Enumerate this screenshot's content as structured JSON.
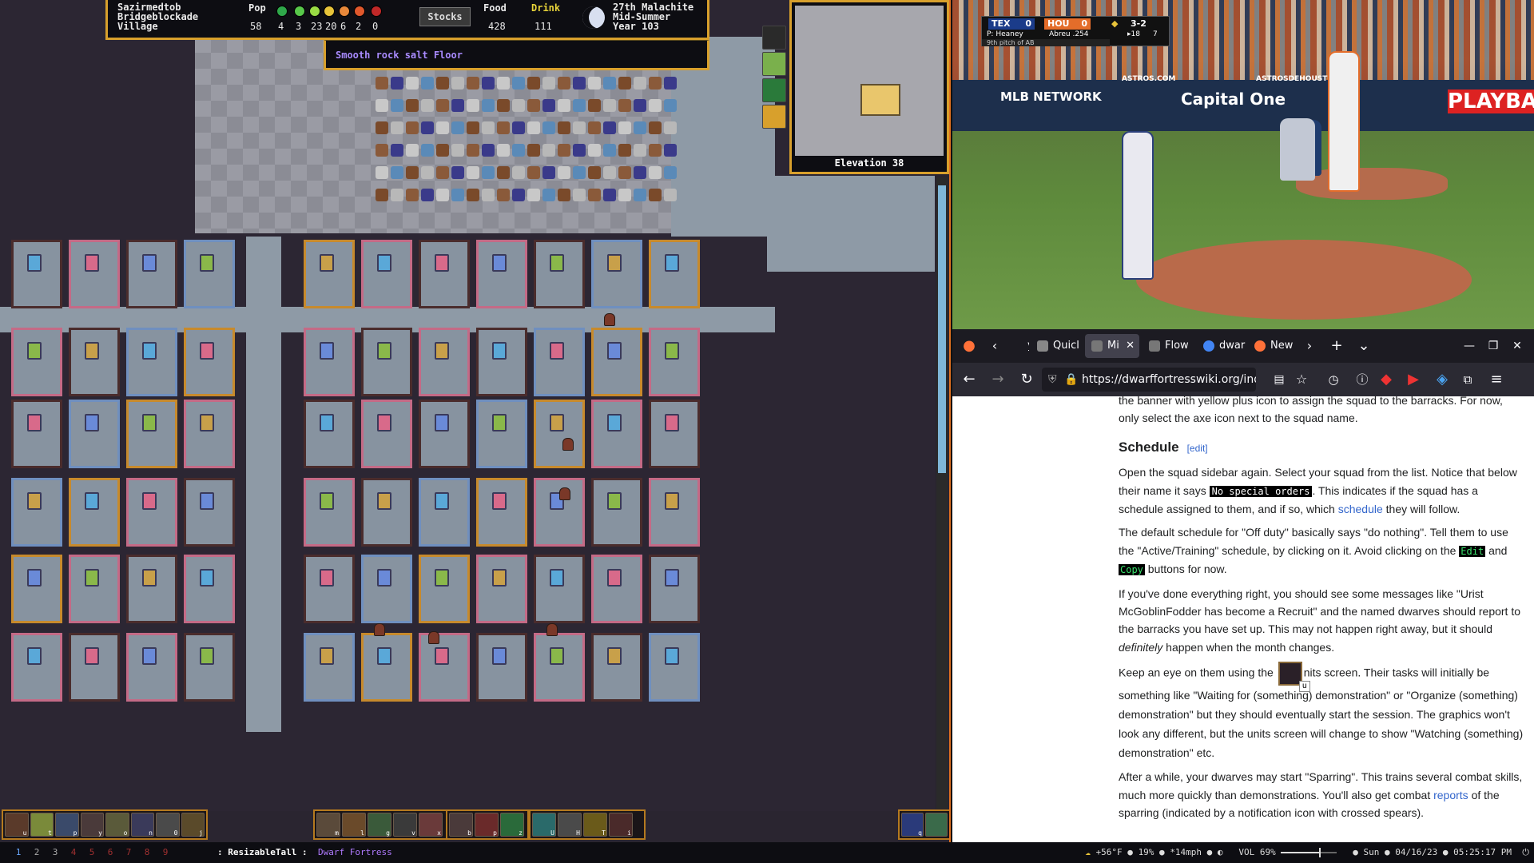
{
  "df": {
    "fort_lines": [
      "Sazirmedtob",
      "Bridgeblockade",
      "Village"
    ],
    "pop_label": "Pop",
    "pop_value": "58",
    "happiness_counts": [
      "4",
      "3",
      "23",
      "20",
      "6",
      "2",
      "0"
    ],
    "happiness_colors": [
      "#2fa84a",
      "#58c84a",
      "#9adc44",
      "#e8c43a",
      "#e8883a",
      "#e0582c",
      "#c02828"
    ],
    "stocks_label": "Stocks",
    "food_label": "Food",
    "food_value": "428",
    "drink_label": "Drink",
    "drink_value": "111",
    "date_lines": [
      "27th Malachite",
      "Mid-Summer",
      "Year 103"
    ],
    "hover_text": "Smooth rock salt Floor",
    "elevation": "Elevation 38",
    "toolbar_left_keys": [
      "u",
      "t",
      "p",
      "y",
      "o",
      "n",
      "0",
      "j"
    ],
    "toolbar_mid1_keys": [
      "m",
      "l",
      "g",
      "v",
      "x"
    ],
    "toolbar_mid2_keys": [
      "b",
      "p",
      "z"
    ],
    "toolbar_mid3_keys": [
      "U",
      "H",
      "T",
      "i"
    ],
    "toolbar_right_keys": [
      "q",
      ""
    ]
  },
  "video": {
    "away_team": "TEX",
    "away_score": "0",
    "home_team": "HOU",
    "home_score": "0",
    "count": "3-2",
    "inning": "▸18",
    "pitches": "7",
    "pitcher_label": "P: Heaney",
    "batter_label": "Abreu .254",
    "pitch_info": "9th pitch of AB",
    "ads": [
      "MLB NETWORK",
      "Capital One",
      "ASTROS.COM",
      "ASTROSDEHOUSTON",
      "PLAYBA"
    ]
  },
  "firefox": {
    "tabs": [
      {
        "label": "yi",
        "active": false
      },
      {
        "label": "Quicl",
        "active": false
      },
      {
        "label": "Mi",
        "active": true
      },
      {
        "label": "Flow",
        "active": false
      },
      {
        "label": "dwar",
        "active": false
      },
      {
        "label": "New",
        "active": false
      }
    ],
    "url": "https://dwarffortresswiki.org/inde",
    "nav": {
      "back": "←",
      "forward": "→",
      "reload": "↻",
      "menu": "≡",
      "new_tab": "+",
      "list_tabs": "⌄"
    }
  },
  "wiki": {
    "intro_tail": "the banner with yellow plus icon to assign the squad to the barracks. For now, only select the axe icon next to the squad name.",
    "heading": "Schedule",
    "edit_link": "[edit]",
    "p1_a": "Open the squad sidebar again. Select your squad from the list. Notice that below their name it says ",
    "p1_code": "No special orders",
    "p1_b": ". This indicates if the squad has a schedule assigned to them, and if so, which ",
    "p1_link": "schedule",
    "p1_c": " they will follow.",
    "p2_a": "The default schedule for \"Off duty\" basically says \"do nothing\". Tell them to use the \"Active/Training\" schedule, by clicking on it. Avoid clicking on the ",
    "p2_edit": "Edit",
    "p2_and": " and ",
    "p2_copy": "Copy",
    "p2_b": " buttons for now.",
    "p3_a": "If you've done everything right, you should see some messages like \"Urist McGoblinFodder has become a Recruit\" and the named dwarves should report to the barracks you have set up. This may not happen right away, but it should ",
    "p3_em": "definitely",
    "p3_b": " happen when the month changes.",
    "p4_a": "Keep an eye on them using the ",
    "p4_key": "u",
    "p4_b": "nits screen. Their tasks will initially be something like \"Waiting for (something) demonstration\" or \"Organize (something) demonstration\" but they should eventually start the session. The graphics won't look any different, but the units screen will change to show \"Watching (something) demonstration\" etc.",
    "p5_a": "After a while, your dwarves may start \"Sparring\". This trains several combat skills, much more quickly than demonstrations. You'll also get combat ",
    "p5_link": "reports",
    "p5_b": " of the sparring (indicated by a notification icon with crossed spears)."
  },
  "statusbar": {
    "workspaces": [
      "1",
      "2",
      "3",
      "4",
      "5",
      "6",
      "7",
      "8",
      "9"
    ],
    "layout": ": ResizableTall :",
    "window_title": "Dwarf Fortress",
    "weather": "+56°F",
    "humidity": "19%",
    "wind": "*14mph",
    "volume": "VOL 69%",
    "date": "Sun",
    "date2": "04/16/23",
    "time": "05:25:17 PM"
  }
}
